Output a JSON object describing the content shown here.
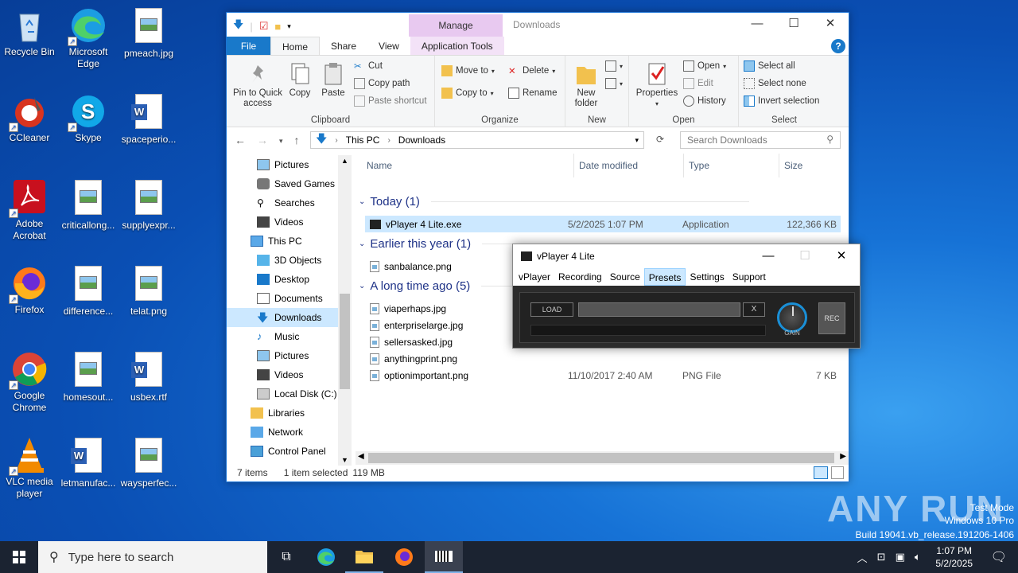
{
  "desktop": {
    "icons": [
      {
        "label": "Recycle Bin",
        "icon": "recycle-bin-icon"
      },
      {
        "label": "Microsoft Edge",
        "icon": "edge-icon"
      },
      {
        "label": "pmeach.jpg",
        "icon": "image-file-icon"
      },
      {
        "label": "CCleaner",
        "icon": "ccleaner-icon"
      },
      {
        "label": "Skype",
        "icon": "skype-icon"
      },
      {
        "label": "spaceperio...",
        "icon": "word-doc-icon"
      },
      {
        "label": "Adobe Acrobat",
        "icon": "acrobat-icon"
      },
      {
        "label": "criticallong...",
        "icon": "image-file-icon"
      },
      {
        "label": "supplyexpr...",
        "icon": "image-file-icon"
      },
      {
        "label": "Firefox",
        "icon": "firefox-icon"
      },
      {
        "label": "difference...",
        "icon": "image-file-icon"
      },
      {
        "label": "telat.png",
        "icon": "image-file-icon"
      },
      {
        "label": "Google Chrome",
        "icon": "chrome-icon"
      },
      {
        "label": "homesout...",
        "icon": "image-file-icon"
      },
      {
        "label": "usbex.rtf",
        "icon": "word-doc-icon"
      },
      {
        "label": "VLC media player",
        "icon": "vlc-icon"
      },
      {
        "label": "letmanufac...",
        "icon": "word-doc-icon"
      },
      {
        "label": "waysperfec...",
        "icon": "image-file-icon"
      }
    ]
  },
  "explorer": {
    "title": "Downloads",
    "manage_label": "Manage",
    "tabs": {
      "file": "File",
      "home": "Home",
      "share": "Share",
      "view": "View",
      "app_tools": "Application Tools",
      "help": "?"
    },
    "ribbon": {
      "pin": "Pin to Quick access",
      "copy": "Copy",
      "paste": "Paste",
      "cut": "Cut",
      "copy_path": "Copy path",
      "paste_shortcut": "Paste shortcut",
      "clipboard": "Clipboard",
      "move_to": "Move to",
      "copy_to": "Copy to",
      "delete": "Delete",
      "rename": "Rename",
      "organize": "Organize",
      "new_folder": "New folder",
      "new": "New",
      "properties": "Properties",
      "open": "Open",
      "edit": "Edit",
      "history": "History",
      "open_group": "Open",
      "select_all": "Select all",
      "select_none": "Select none",
      "invert": "Invert selection",
      "select": "Select"
    },
    "address": {
      "this_pc": "This PC",
      "downloads": "Downloads",
      "search_placeholder": "Search Downloads"
    },
    "nav": [
      "Pictures",
      "Saved Games",
      "Searches",
      "Videos",
      "This PC",
      "3D Objects",
      "Desktop",
      "Documents",
      "Downloads",
      "Music",
      "Pictures",
      "Videos",
      "Local Disk (C:)",
      "Libraries",
      "Network",
      "Control Panel"
    ],
    "columns": {
      "name": "Name",
      "date": "Date modified",
      "type": "Type",
      "size": "Size"
    },
    "groups": {
      "today": "Today (1)",
      "earlier": "Earlier this year (1)",
      "long_ago": "A long time ago (5)"
    },
    "files": [
      {
        "name": "vPlayer 4 Lite.exe",
        "date": "5/2/2025 1:07 PM",
        "type": "Application",
        "size": "122,366 KB"
      },
      {
        "name": "sanbalance.png",
        "date": "",
        "type": "",
        "size": ""
      },
      {
        "name": "viaperhaps.jpg",
        "date": "",
        "type": "",
        "size": ""
      },
      {
        "name": "enterpriselarge.jpg",
        "date": "",
        "type": "",
        "size": ""
      },
      {
        "name": "sellersasked.jpg",
        "date": "",
        "type": "",
        "size": ""
      },
      {
        "name": "anythingprint.png",
        "date": "",
        "type": "",
        "size": ""
      },
      {
        "name": "optionimportant.png",
        "date": "11/10/2017 2:40 AM",
        "type": "PNG File",
        "size": "7 KB"
      }
    ],
    "status": {
      "count": "7 items",
      "selected": "1 item selected",
      "size": "119 MB"
    }
  },
  "vplayer": {
    "title": "vPlayer 4 Lite",
    "menu": [
      "vPlayer",
      "Recording",
      "Source",
      "Presets",
      "Settings",
      "Support"
    ],
    "load": "LOAD",
    "x": "X",
    "gain": "GAIN",
    "rec": "REC"
  },
  "watermark": {
    "logo": "ANY RUN",
    "mode": "Test Mode",
    "os": "Windows 10 Pro",
    "build": "Build 19041.vb_release.191206-1406"
  },
  "taskbar": {
    "search_placeholder": "Type here to search",
    "time": "1:07 PM",
    "date": "5/2/2025"
  }
}
